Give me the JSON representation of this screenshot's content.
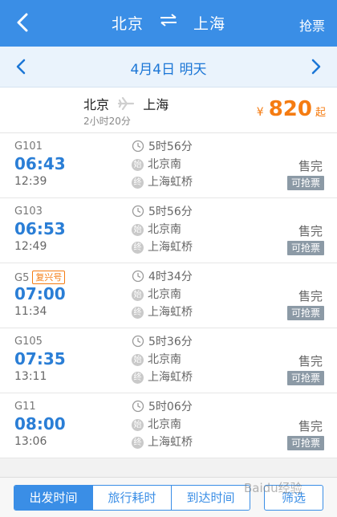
{
  "header": {
    "from": "北京",
    "to": "上海",
    "right_action": "抢票",
    "back_icon": "chevron-left-icon",
    "swap_icon": "swap-arrows-icon"
  },
  "datebar": {
    "date_text": "4月4日 明天",
    "prev_icon": "chevron-left-icon",
    "next_icon": "chevron-right-icon"
  },
  "summary": {
    "from": "北京",
    "to": "上海",
    "duration": "2小时20分",
    "currency": "¥",
    "price": "820",
    "price_suffix": "起",
    "plane_icon": "plane-icon"
  },
  "trains": [
    {
      "no": "G101",
      "badge": "",
      "dep": "06:43",
      "arr": "12:39",
      "duration": "5时56分",
      "from_mark": "始",
      "from": "北京南",
      "to_mark": "终",
      "to": "上海虹桥",
      "status": "售完",
      "action": "可抢票"
    },
    {
      "no": "G103",
      "badge": "",
      "dep": "06:53",
      "arr": "12:49",
      "duration": "5时56分",
      "from_mark": "始",
      "from": "北京南",
      "to_mark": "终",
      "to": "上海虹桥",
      "status": "售完",
      "action": "可抢票"
    },
    {
      "no": "G5",
      "badge": "复兴号",
      "dep": "07:00",
      "arr": "11:34",
      "duration": "4时34分",
      "from_mark": "始",
      "from": "北京南",
      "to_mark": "终",
      "to": "上海虹桥",
      "status": "售完",
      "action": "可抢票"
    },
    {
      "no": "G105",
      "badge": "",
      "dep": "07:35",
      "arr": "13:11",
      "duration": "5时36分",
      "from_mark": "始",
      "from": "北京南",
      "to_mark": "终",
      "to": "上海虹桥",
      "status": "售完",
      "action": "可抢票"
    },
    {
      "no": "G11",
      "badge": "",
      "dep": "08:00",
      "arr": "13:06",
      "duration": "5时06分",
      "from_mark": "始",
      "from": "北京南",
      "to_mark": "终",
      "to": "上海虹桥",
      "status": "售完",
      "action": "可抢票"
    }
  ],
  "footer": {
    "sort_options": [
      "出发时间",
      "旅行耗时",
      "到达时间"
    ],
    "active_sort": "出发时间",
    "filter_label": "筛选"
  },
  "watermark": "Baidu经验",
  "colors": {
    "primary": "#3a8ee6",
    "price": "#f57c12",
    "time": "#2a7ed6"
  }
}
